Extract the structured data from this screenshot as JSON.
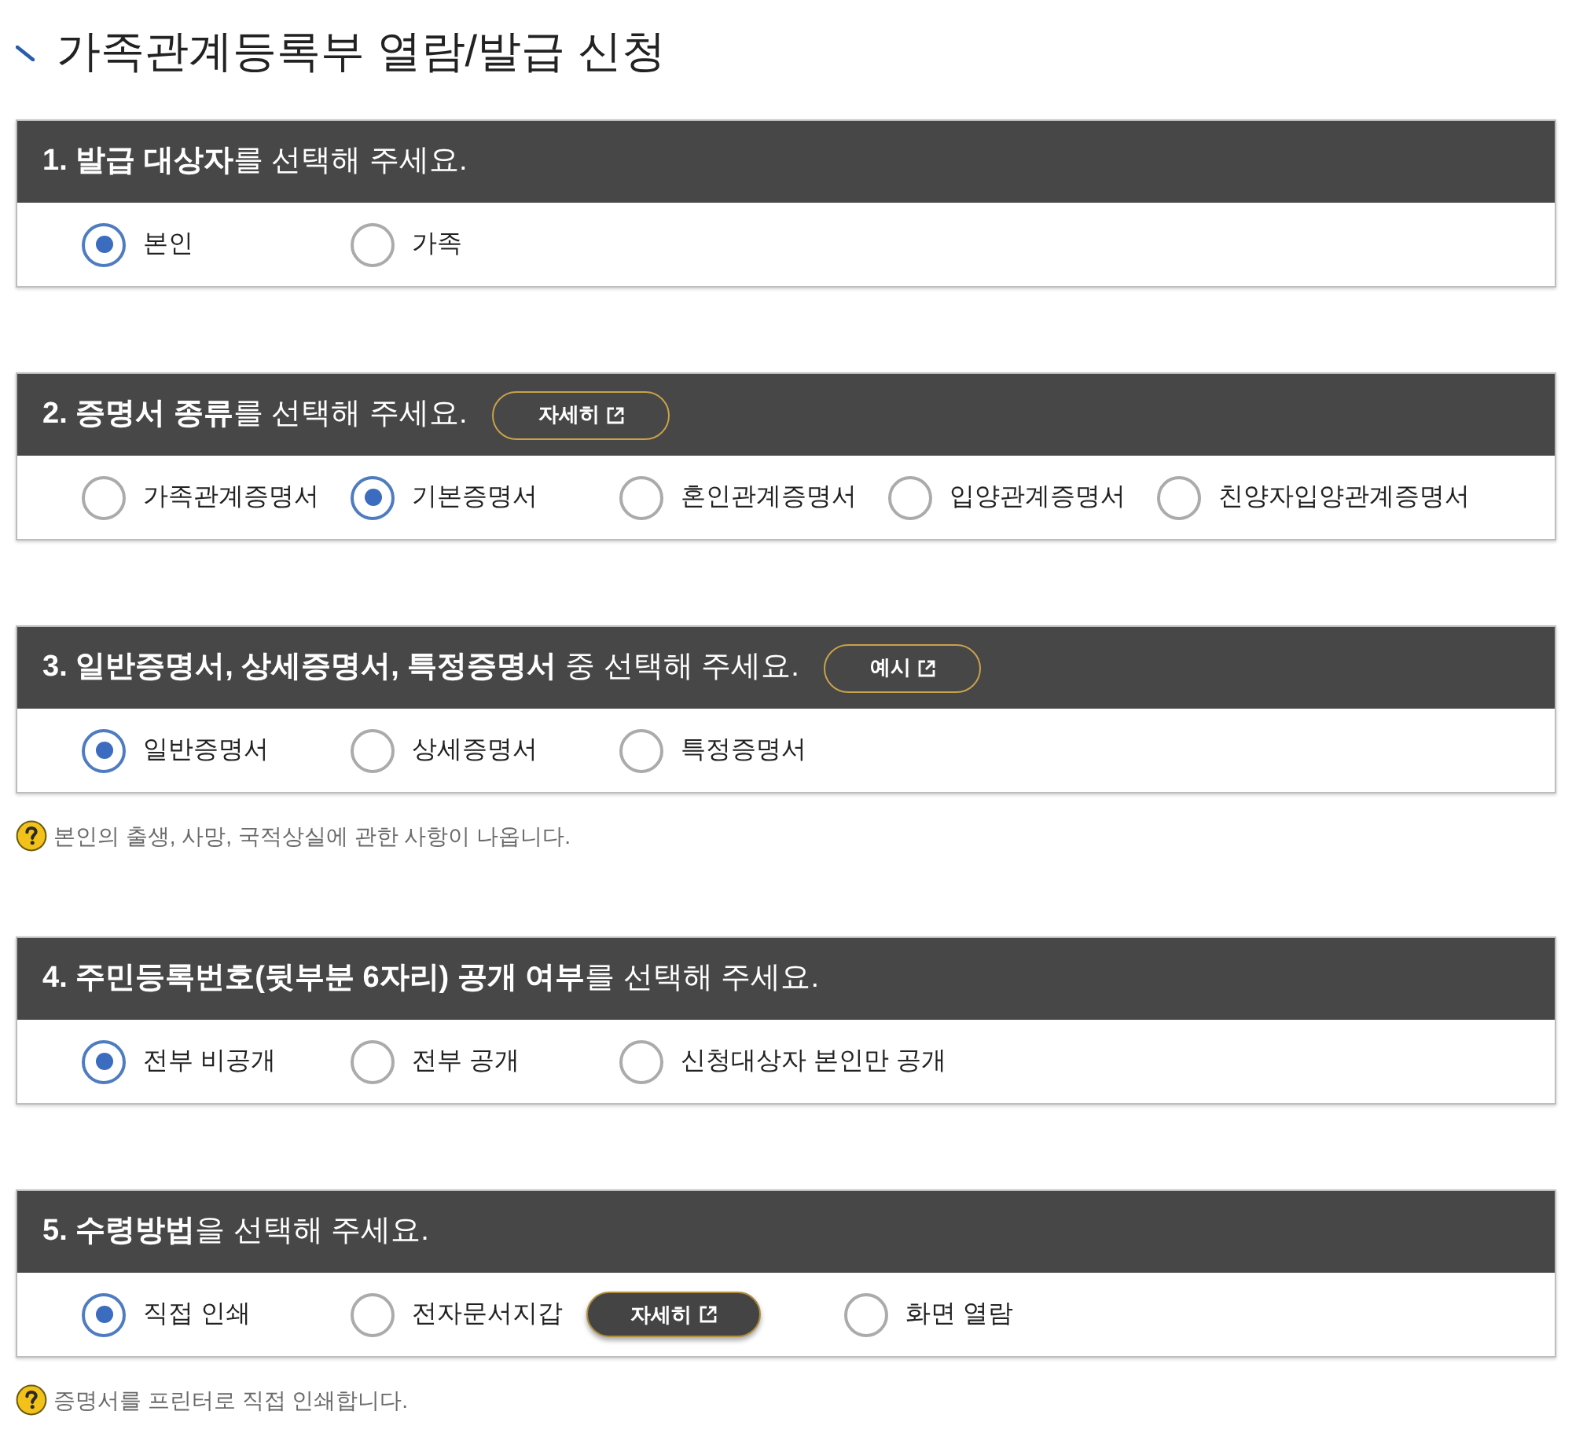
{
  "title": "가족관계등록부 열람/발급 신청",
  "sections": [
    {
      "heading": "**1. 발급 대상자**를 선택해 주세요.",
      "options": [
        {
          "label": "본인",
          "selected": true
        },
        {
          "label": "가족",
          "selected": false
        }
      ]
    },
    {
      "heading": "**2. 증명서 종류**를 선택해 주세요.",
      "header_button": {
        "label": "자세히"
      },
      "options": [
        {
          "label": "가족관계증명서",
          "selected": false
        },
        {
          "label": "기본증명서",
          "selected": true
        },
        {
          "label": "혼인관계증명서",
          "selected": false
        },
        {
          "label": "입양관계증명서",
          "selected": false
        },
        {
          "label": "친양자입양관계증명서",
          "selected": false
        }
      ]
    },
    {
      "heading": "**3. 일반증명서, 상세증명서, 특정증명서** 중 선택해 주세요.",
      "header_button": {
        "label": "예시"
      },
      "options": [
        {
          "label": "일반증명서",
          "selected": true
        },
        {
          "label": "상세증명서",
          "selected": false
        },
        {
          "label": "특정증명서",
          "selected": false
        }
      ],
      "note": "본인의 출생, 사망, 국적상실에 관한 사항이 나옵니다."
    },
    {
      "heading": "**4. 주민등록번호(뒷부분 6자리) 공개 여부**를 선택해 주세요.",
      "options": [
        {
          "label": "전부 비공개",
          "selected": true
        },
        {
          "label": "전부 공개",
          "selected": false
        },
        {
          "label": "신청대상자 본인만 공개",
          "selected": false
        }
      ]
    },
    {
      "heading": "**5. 수령방법**을 선택해 주세요.",
      "options": [
        {
          "label": "직접 인쇄",
          "selected": true
        },
        {
          "label": "전자문서지갑",
          "selected": false,
          "button": {
            "label": "자세히"
          }
        },
        {
          "label": "화면 열람",
          "selected": false
        }
      ],
      "note": "증명서를 프린터로 직접 인쇄합니다."
    }
  ]
}
